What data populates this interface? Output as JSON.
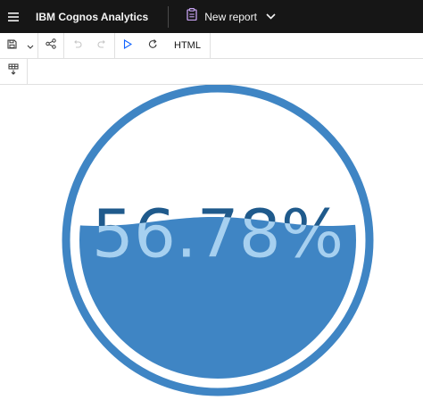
{
  "header": {
    "brand": "IBM Cognos Analytics",
    "report_title": "New report"
  },
  "toolbar": {
    "icons": [
      "save-icon",
      "chevron-down-icon",
      "share-icon",
      "undo-icon",
      "redo-icon",
      "run-icon",
      "refresh-icon"
    ],
    "output_format": "HTML"
  },
  "toolbar2": {
    "icons": [
      "insert-table-icon"
    ]
  },
  "gauge": {
    "value_label": "56.78%",
    "fill_fraction": 0.5678,
    "colors": {
      "ring": "#3f85c4",
      "fill": "#3f85c4",
      "text_on_white": "#1f5a8c",
      "text_on_fill": "#a6d0f0",
      "background": "#ffffff"
    }
  }
}
